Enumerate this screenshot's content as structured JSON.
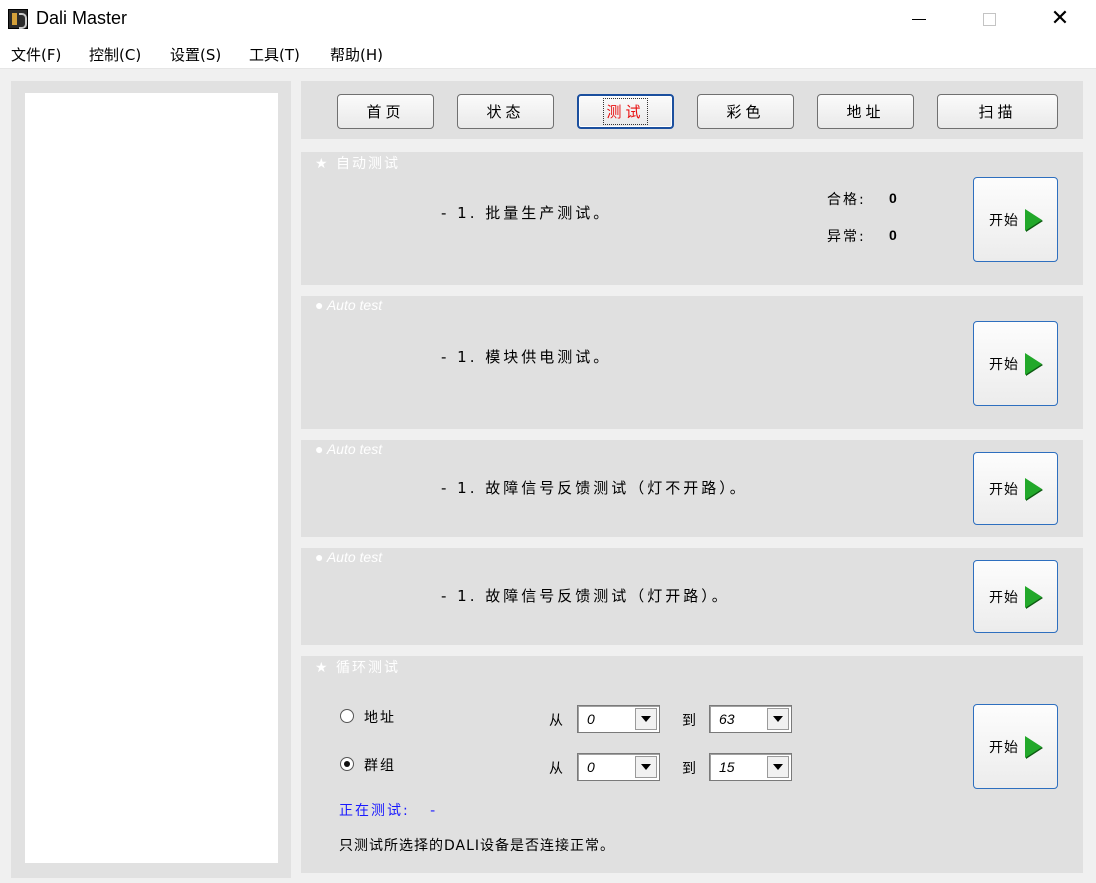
{
  "window": {
    "title": "Dali Master",
    "minimize": "",
    "maximize": "",
    "close": "✕"
  },
  "menu": [
    "文件(F)",
    "控制(C)",
    "设置(S)",
    "工具(T)",
    "帮助(H)"
  ],
  "tabs": [
    "首页",
    "状态",
    "测试",
    "彩色",
    "地址",
    "扫描"
  ],
  "active_tab": "测试",
  "sections": {
    "batch": {
      "title": "★ 自动测试",
      "text": "- 1. 批量生产测试。",
      "pass_label": "合格:",
      "pass_value": "0",
      "fail_label": "异常:",
      "fail_value": "0",
      "start_label": "开始"
    },
    "power": {
      "title": "● Auto test",
      "text": "- 1. 模块供电测试。",
      "start_label": "开始"
    },
    "fault_open": {
      "title": "● Auto test",
      "text": "- 1. 故障信号反馈测试（灯不开路）。",
      "start_label": "开始"
    },
    "fault_closed": {
      "title": "● Auto test",
      "text": "- 1. 故障信号反馈测试（灯开路）。",
      "start_label": "开始"
    },
    "loop": {
      "title": "★ 循环测试",
      "address_label": "地址",
      "group_label": "群组",
      "from_label": "从",
      "to_label": "到",
      "address_from": "0",
      "address_to": "63",
      "group_from": "0",
      "group_to": "15",
      "selected": "group",
      "status_label": "正在测试:",
      "status_value": "-",
      "note": "只测试所选择的DALI设备是否连接正常。",
      "start_label": "开始"
    }
  },
  "colors": {
    "active_tab_text": "#e81010",
    "status_text": "#1a1aff",
    "play_icon": "#22a82a",
    "panel_bg": "#e0e0e0"
  }
}
